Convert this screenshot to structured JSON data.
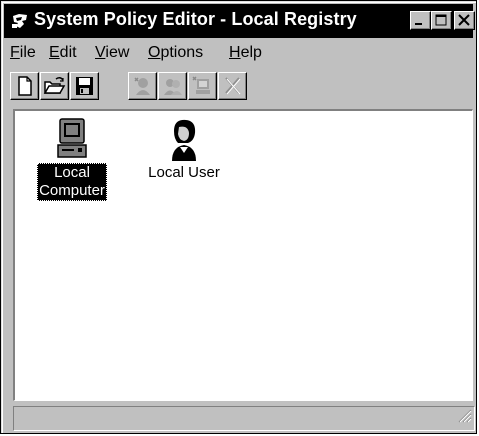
{
  "window": {
    "title": "System Policy Editor - Local Registry"
  },
  "titlebar_buttons": [
    "minimize-icon",
    "maximize-icon",
    "close-icon"
  ],
  "menu": [
    {
      "label": "File",
      "mnemonic": "F",
      "rest": "ile"
    },
    {
      "label": "Edit",
      "mnemonic": "E",
      "rest": "dit"
    },
    {
      "label": "View",
      "mnemonic": "V",
      "rest": "iew"
    },
    {
      "label": "Options",
      "mnemonic": "O",
      "rest": "ptions"
    },
    {
      "label": "Help",
      "mnemonic": "H",
      "rest": "elp"
    }
  ],
  "toolbar": [
    {
      "icon": "new-document-icon",
      "enabled": true
    },
    {
      "icon": "open-folder-icon",
      "enabled": true
    },
    {
      "icon": "save-disk-icon",
      "enabled": true
    },
    {
      "icon": "add-user-icon",
      "enabled": false
    },
    {
      "icon": "add-group-icon",
      "enabled": false
    },
    {
      "icon": "add-computer-icon",
      "enabled": false
    },
    {
      "icon": "remove-icon",
      "enabled": false
    }
  ],
  "items": [
    {
      "line1": "Local",
      "line2": "Computer",
      "icon": "computer-icon",
      "selected": true
    },
    {
      "line1": "Local User",
      "line2": "",
      "icon": "user-icon",
      "selected": false
    }
  ],
  "status": {
    "text": ""
  },
  "colors": {
    "face": "#c0c0c0",
    "titlebar": "#000000",
    "selection": "#000000",
    "client": "#ffffff"
  }
}
